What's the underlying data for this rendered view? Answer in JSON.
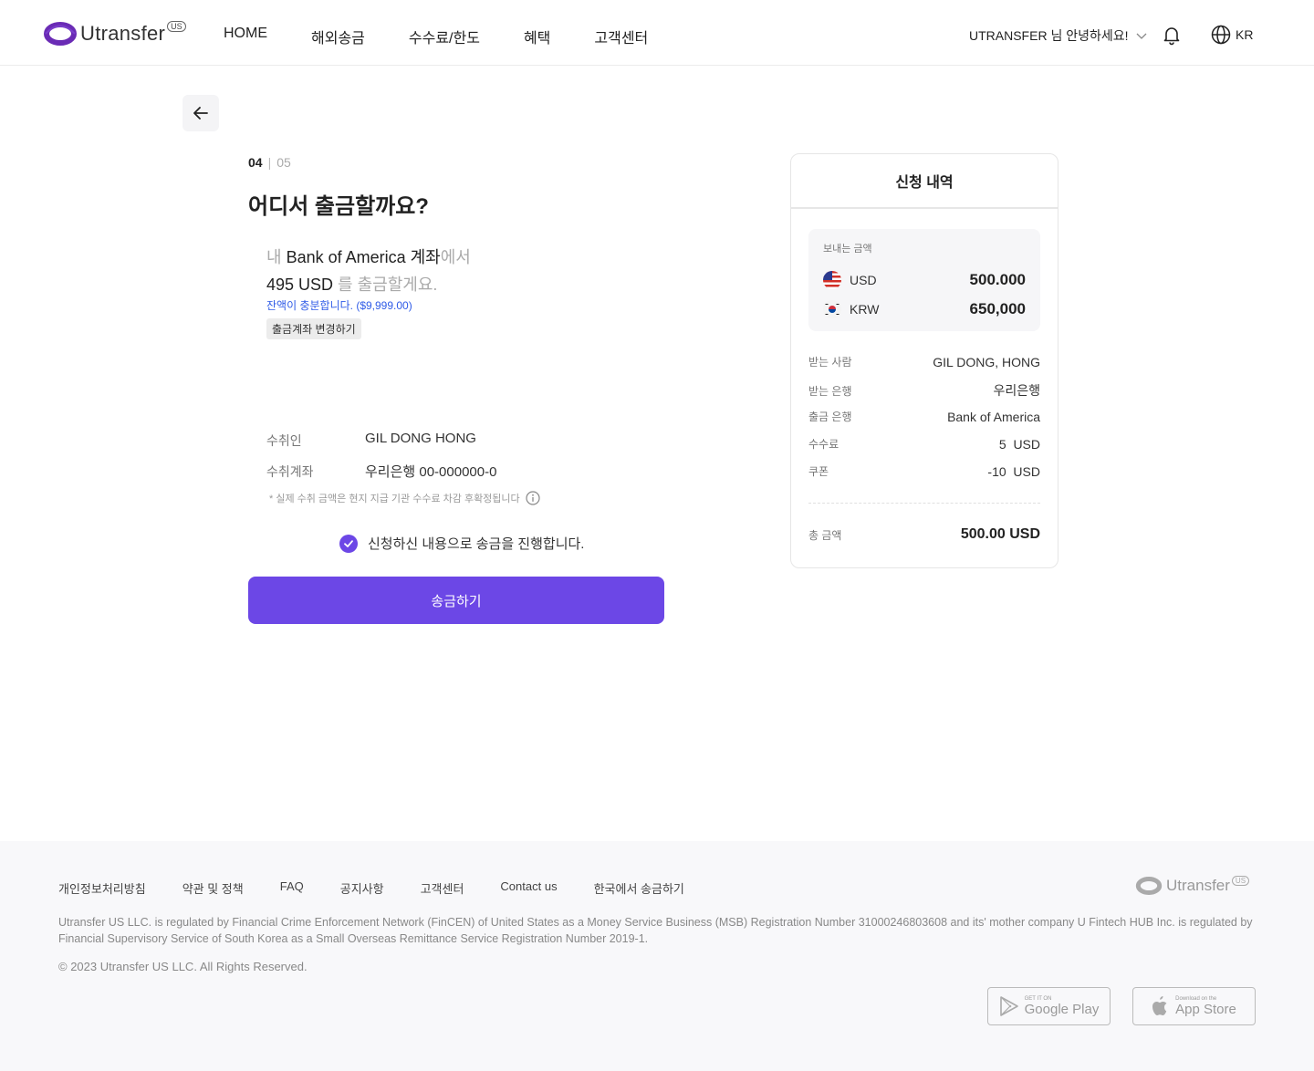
{
  "header": {
    "logo_text": "Utransfer",
    "logo_badge": "US",
    "nav": [
      "HOME",
      "해외송금",
      "수수료/한도",
      "혜택",
      "고객센터"
    ],
    "greeting": "UTRANSFER 님 안녕하세요!",
    "lang": "KR"
  },
  "step": {
    "current": "04",
    "total": "05"
  },
  "page_title": "어디서 출금할까요?",
  "withdraw": {
    "prefix": "내 ",
    "account": "Bank of America 계좌",
    "suffix": "에서",
    "amount": "495 USD",
    "amount_suffix": " 를 출금할게요.",
    "balance_note": "잔액이 충분합니다. ($9,999.00)",
    "change_button": "출금계좌 변경하기"
  },
  "recipient": {
    "name_label": "수취인",
    "name_value": "GIL DONG HONG",
    "account_label": "수취계좌",
    "account_value": "우리은행 00-000000-0",
    "note": "* 실제 수취 금액은 현지 지급 기관 수수료 차감 후확정됩니다"
  },
  "agree_text": "신청하신 내용으로 송금을 진행합니다.",
  "submit_label": "송금하기",
  "summary": {
    "title": "신청 내역",
    "send_label": "보내는 금액",
    "usd_code": "USD",
    "usd_value": "500.000",
    "krw_code": "KRW",
    "krw_value": "650,000",
    "rows": [
      {
        "k": "받는 사람",
        "v": "GIL DONG, HONG"
      },
      {
        "k": "받는 은행",
        "v": "우리은행"
      },
      {
        "k": "출금 은행",
        "v": "Bank of America"
      },
      {
        "k": "수수료",
        "v": "5  USD"
      },
      {
        "k": "쿠폰",
        "v": "-10  USD"
      }
    ],
    "total_label": "총 금액",
    "total_value": "500.00 USD"
  },
  "footer": {
    "links": [
      "개인정보처리방침",
      "약관 및 정책",
      "FAQ",
      "공지사항",
      "고객센터",
      "Contact us",
      "한국에서 송금하기"
    ],
    "logo_text": "Utransfer",
    "logo_badge": "US",
    "legal": "Utransfer US LLC. is regulated by Financial Crime Enforcement Network (FinCEN) of United States as a Money Service Business (MSB) Registration Number 31000246803608 and its' mother company U Fintech HUB Inc. is regulated by Financial Supervisory Service of South Korea as a Small Overseas Remittance Service Registration Number 2019-1.",
    "copyright": "© 2023 Utransfer US LLC. All Rights Reserved.",
    "google_small": "GET IT ON",
    "google_big": "Google Play",
    "apple_small": "Download on the",
    "apple_big": "App Store"
  },
  "colors": {
    "accent": "#6c47e6",
    "info": "#2f5be7"
  }
}
